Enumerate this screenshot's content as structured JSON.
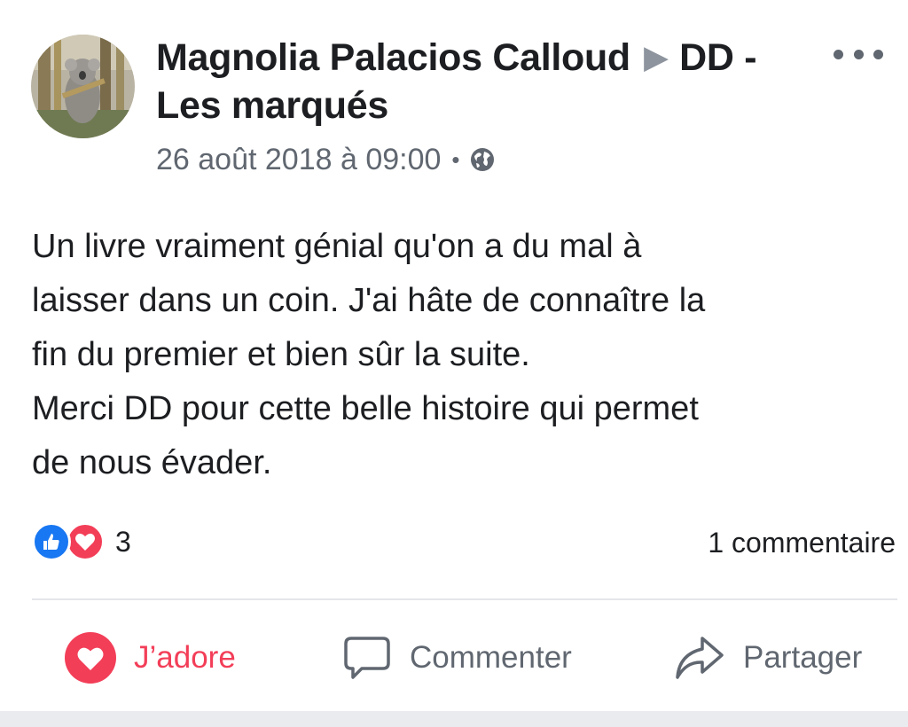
{
  "post": {
    "author": "Magnolia Palacios Calloud",
    "target_arrow": "▶",
    "target_page": "DD - Les marqués",
    "timestamp": "26 août 2018 à 09:00",
    "separator": "•",
    "privacy_icon": "globe-icon",
    "text": "Un livre vraiment génial qu'on a du mal à\nlaisser dans un coin. J'ai hâte de connaître la\nfin du premier et bien sûr la suite.\nMerci DD pour cette belle histoire qui permet\nde nous évader."
  },
  "reactions": {
    "icons": [
      "like-icon",
      "love-icon"
    ],
    "count": "3"
  },
  "comments": {
    "count_label": "1 commentaire"
  },
  "actions": {
    "love_label": "J’adore",
    "comment_label": "Commenter",
    "share_label": "Partager"
  },
  "colors": {
    "text": "#1c1e21",
    "secondary": "#606770",
    "love": "#f33e58",
    "like": "#1877f2",
    "divider": "#e4e6eb"
  }
}
